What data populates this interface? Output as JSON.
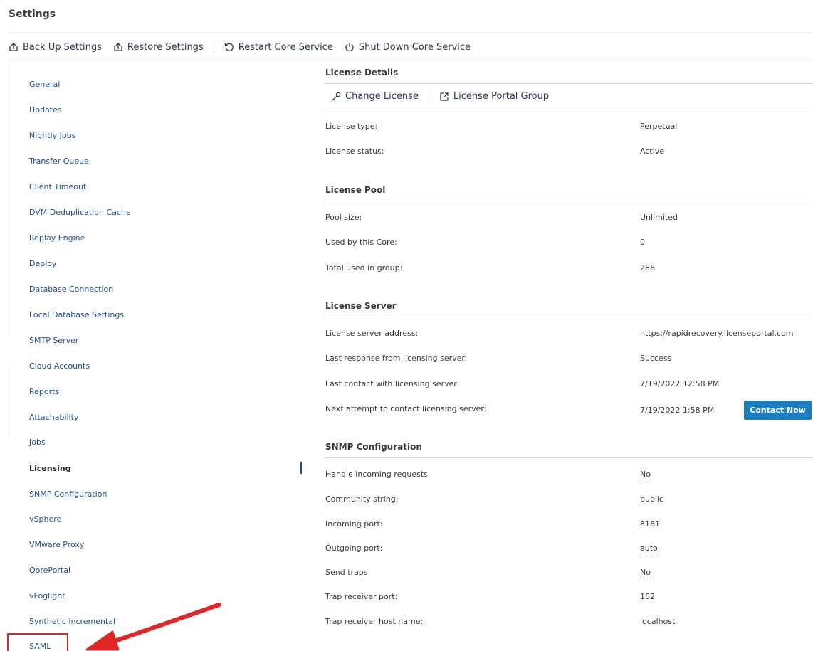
{
  "page": {
    "title": "Settings"
  },
  "toolbar": {
    "backup_label": "Back Up Settings",
    "restore_label": "Restore Settings",
    "restart_label": "Restart Core Service",
    "shutdown_label": "Shut Down Core Service"
  },
  "sidebar": {
    "items": [
      {
        "label": "General"
      },
      {
        "label": "Updates"
      },
      {
        "label": "Nightly Jobs"
      },
      {
        "label": "Transfer Queue"
      },
      {
        "label": "Client Timeout"
      },
      {
        "label": "DVM Deduplication Cache"
      },
      {
        "label": "Replay Engine"
      },
      {
        "label": "Deploy"
      },
      {
        "label": "Database Connection"
      },
      {
        "label": "Local Database Settings"
      },
      {
        "label": "SMTP Server"
      },
      {
        "label": "Cloud Accounts"
      },
      {
        "label": "Reports"
      },
      {
        "label": "Attachability"
      },
      {
        "label": "Jobs"
      },
      {
        "label": "Licensing",
        "active": true
      },
      {
        "label": "SNMP Configuration"
      },
      {
        "label": "vSphere"
      },
      {
        "label": "VMware Proxy"
      },
      {
        "label": "QorePortal"
      },
      {
        "label": "vFoglight"
      },
      {
        "label": "Synthetic incremental"
      },
      {
        "label": "SAML"
      }
    ]
  },
  "license_details": {
    "heading": "License Details",
    "change_license_label": "Change License",
    "portal_group_label": "License Portal Group",
    "rows": [
      {
        "label": "License type:",
        "value": "Perpetual"
      },
      {
        "label": "License status:",
        "value": "Active"
      }
    ]
  },
  "license_pool": {
    "heading": "License Pool",
    "rows": [
      {
        "label": "Pool size:",
        "value": "Unlimited"
      },
      {
        "label": "Used by this Core:",
        "value": "0"
      },
      {
        "label": "Total used in group:",
        "value": "286"
      }
    ]
  },
  "license_server": {
    "heading": "License Server",
    "rows": [
      {
        "label": "License server address:",
        "value": "https://rapidrecovery.licenseportal.com"
      },
      {
        "label": "Last response from licensing server:",
        "value": "Success"
      },
      {
        "label": "Last contact with licensing server:",
        "value": "7/19/2022 12:58 PM"
      },
      {
        "label": "Next attempt to contact licensing server:",
        "value": "7/19/2022 1:58 PM"
      }
    ],
    "contact_now_label": "Contact Now"
  },
  "snmp": {
    "heading": "SNMP Configuration",
    "rows": [
      {
        "label": "Handle incoming requests",
        "value": "No"
      },
      {
        "label": "Community string:",
        "value": "public"
      },
      {
        "label": "Incoming port:",
        "value": "8161"
      },
      {
        "label": "Outgoing port:",
        "value": "auto"
      },
      {
        "label": "Send traps",
        "value": "No"
      },
      {
        "label": "Trap receiver port:",
        "value": "162"
      },
      {
        "label": "Trap receiver host name:",
        "value": "localhost"
      }
    ]
  },
  "colors": {
    "link": "#23508a",
    "button": "#1a7ec1",
    "annotation": "#e12626"
  },
  "icons": {
    "backup": "upload-box-icon",
    "restore": "upload-box-icon",
    "restart": "restart-icon",
    "shutdown": "power-icon",
    "change_license": "key-icon",
    "portal_group": "external-link-icon"
  }
}
